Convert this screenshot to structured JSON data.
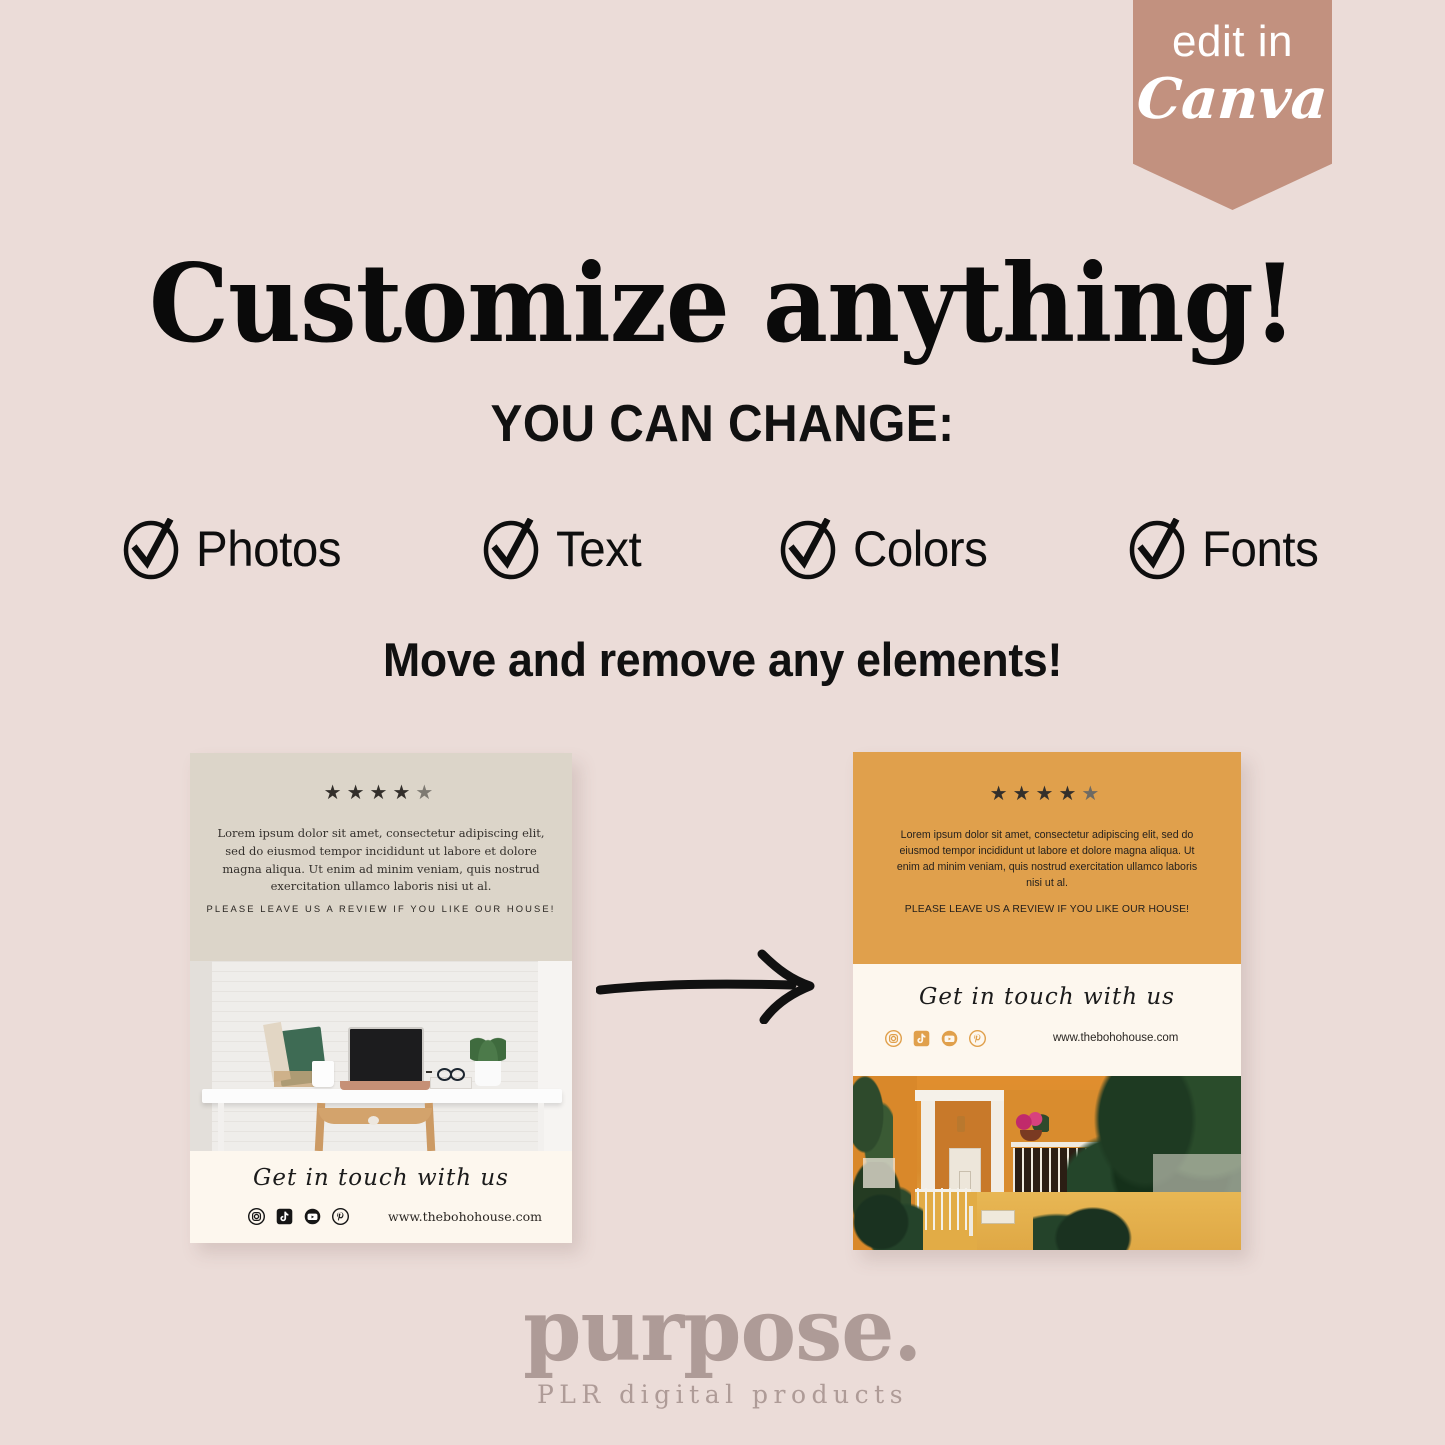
{
  "background_color": "#EBDCD8",
  "ribbon": {
    "line1": "edit in",
    "line2": "Canva",
    "color": "#C2917F",
    "text_color": "#FFFFFF"
  },
  "headline": "Customize anything!",
  "subhead": "YOU CAN CHANGE:",
  "checklist": [
    {
      "icon": "check-circle-icon",
      "label": "Photos"
    },
    {
      "icon": "check-circle-icon",
      "label": "Text"
    },
    {
      "icon": "check-circle-icon",
      "label": "Colors"
    },
    {
      "icon": "check-circle-icon",
      "label": "Fonts"
    }
  ],
  "move_line": "Move and remove any elements!",
  "arrow": {
    "icon": "arrow-right-icon",
    "color": "#111111"
  },
  "cards": {
    "before": {
      "background_color": "#DCD5C9",
      "stars_filled": 4,
      "stars_total": 5,
      "star_color": "#332F2B",
      "star_empty_color": "#7E7A72",
      "review_text": "Lorem ipsum dolor sit amet, consectetur adipiscing elit, sed do eiusmod tempor incididunt ut labore et dolore magna aliqua. Ut enim ad minim veniam, quis nostrud exercitation ullamco laboris nisi ut al.",
      "cta": "PLEASE LEAVE US A REVIEW IF YOU LIKE OUR HOUSE!",
      "photo": "desk-workspace-photo",
      "footer": {
        "background_color": "#FDF7EE",
        "script_text": "Get in touch with us",
        "website": "www.thebohohouse.com",
        "social_icons": [
          "instagram-icon",
          "tiktok-icon",
          "youtube-icon",
          "pinterest-icon"
        ],
        "social_icon_color": "#161616"
      }
    },
    "after": {
      "background_color": "#E0A04C",
      "stars_filled": 4,
      "stars_total": 5,
      "star_color": "#332F2B",
      "star_empty_color": "#6E6A63",
      "review_text": "Lorem ipsum dolor sit amet, consectetur adipiscing elit, sed do eiusmod tempor incididunt ut labore et dolore magna aliqua. Ut enim ad minim veniam, quis nostrud exercitation ullamco laboris nisi ut al.",
      "cta": "PLEASE LEAVE US A REVIEW IF YOU LIKE OUR HOUSE!",
      "photo": "orange-house-facade-photo",
      "house_number": "83",
      "band": {
        "background_color": "#FDF7EE",
        "script_text": "Get in touch with us",
        "website": "www.thebohohouse.com",
        "social_icons": [
          "instagram-icon",
          "tiktok-icon",
          "youtube-icon",
          "pinterest-icon"
        ],
        "social_icon_color": "#E0A04C"
      }
    }
  },
  "logo": {
    "main": "purpose.",
    "sub": "PLR digital products",
    "color": "#AE9B97"
  }
}
